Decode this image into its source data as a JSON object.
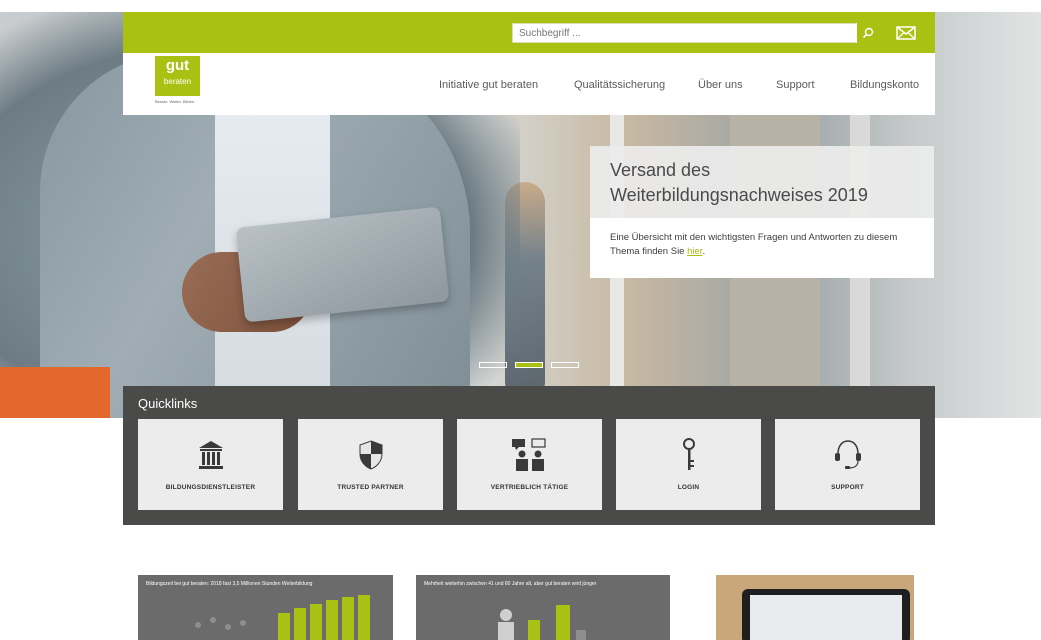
{
  "header": {
    "search_placeholder": "Suchbegriff ...",
    "nav": [
      {
        "label": "Initiative gut beraten"
      },
      {
        "label": "Qualitätssicherung"
      },
      {
        "label": "Über uns"
      },
      {
        "label": "Support"
      },
      {
        "label": "Bildungskonto"
      }
    ]
  },
  "logo": {
    "line1": "gut",
    "line2": "beraten",
    "tagline": "Besser. Weiter. Bilden."
  },
  "hero": {
    "title_line1": "Versand des",
    "title_line2": "Weiterbildungsnachweises 2019",
    "body": "Eine Übersicht mit den wichtigsten Fragen und Antworten zu diesem Thema finden Sie ",
    "link": "hier",
    "body_end": ".",
    "slider": {
      "total": 3,
      "active": 2
    }
  },
  "quicklinks": {
    "title": "Quicklinks",
    "items": [
      {
        "label": "BILDUNGSDIENSTLEISTER",
        "icon": "institution-icon"
      },
      {
        "label": "TRUSTED PARTNER",
        "icon": "shield-icon"
      },
      {
        "label": "VERTRIEBLICH TÄTIGE",
        "icon": "people-chat-icon"
      },
      {
        "label": "LOGIN",
        "icon": "key-icon"
      },
      {
        "label": "SUPPORT",
        "icon": "headset-icon"
      }
    ]
  },
  "teasers": [
    {
      "text": "Bildungszeit bei gut beraten: 2018 fast 3,5 Millionen Stunden Weiterbildung"
    },
    {
      "text": "Mehrheit weiterhin zwischen 41 und 60 Jahre alt, aber gut beraten wird jünger"
    },
    {
      "text": ""
    }
  ],
  "colors": {
    "brand_green": "#a9c113",
    "dark_panel": "#4a4a49"
  }
}
